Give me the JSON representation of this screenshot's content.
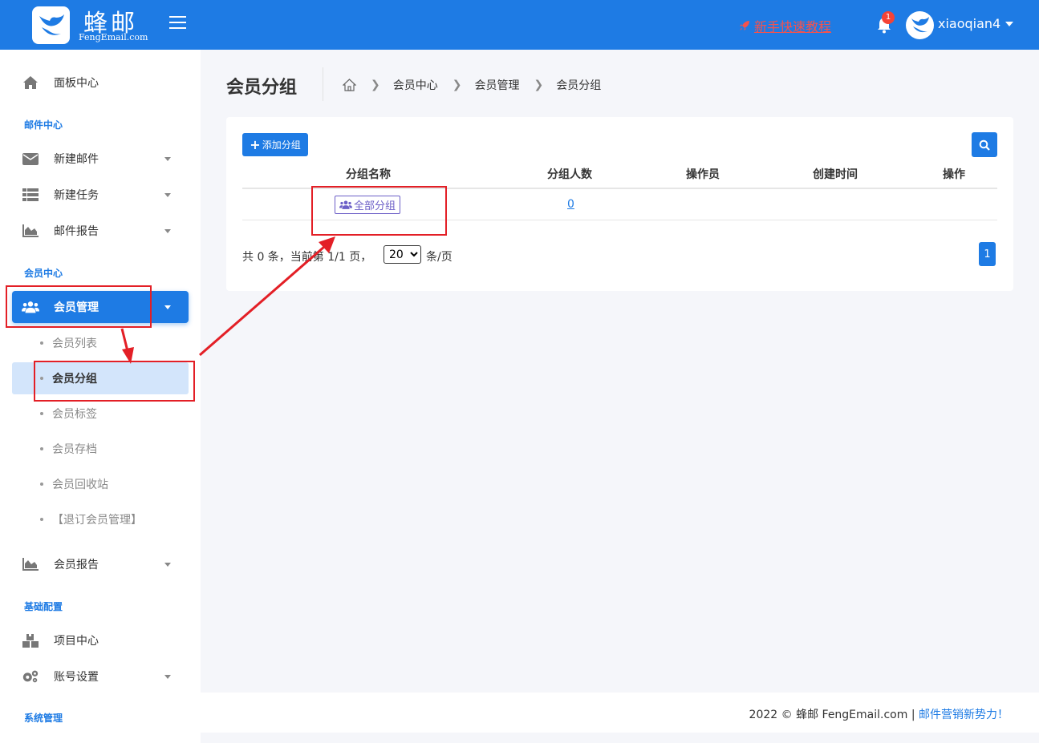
{
  "header": {
    "brand_cn": "蜂邮",
    "brand_en": "FengEmail.com",
    "tutorial_label": "新手快速教程",
    "notification_count": "1",
    "username": "xiaoqian4"
  },
  "sidebar": {
    "dashboard": "面板中心",
    "mail_section": "邮件中心",
    "new_mail": "新建邮件",
    "new_task": "新建任务",
    "mail_report": "邮件报告",
    "member_section": "会员中心",
    "member_manage": "会员管理",
    "member_sub": [
      "会员列表",
      "会员分组",
      "会员标签",
      "会员存档",
      "会员回收站",
      "【退订会员管理】"
    ],
    "member_report": "会员报告",
    "basic_section": "基础配置",
    "project_center": "项目中心",
    "account_settings": "账号设置",
    "system_section": "系统管理"
  },
  "page": {
    "title": "会员分组",
    "breadcrumb": [
      "会员中心",
      "会员管理",
      "会员分组"
    ]
  },
  "toolbar": {
    "add_group": "添加分组"
  },
  "table": {
    "headers": [
      "分组名称",
      "分组人数",
      "操作员",
      "创建时间",
      "操作"
    ],
    "rows": [
      {
        "name": "全部分组",
        "count": "0",
        "operator": "",
        "created": "",
        "action": ""
      }
    ]
  },
  "pagination": {
    "summary": "共 0 条，当前第 1/1 页，",
    "page_size": "20",
    "page_size_options": [
      "20"
    ],
    "unit": "条/页",
    "current_page": "1"
  },
  "footer": {
    "copyright": "2022 © 蜂邮 FengEmail.com | ",
    "slogan": "邮件营销新势力！"
  },
  "colors": {
    "primary": "#1e7be4",
    "tutorial": "#f7524c",
    "tag": "#6c5fc7",
    "annotation": "#e31f26",
    "active_sub_bg": "#d3e5fb"
  }
}
